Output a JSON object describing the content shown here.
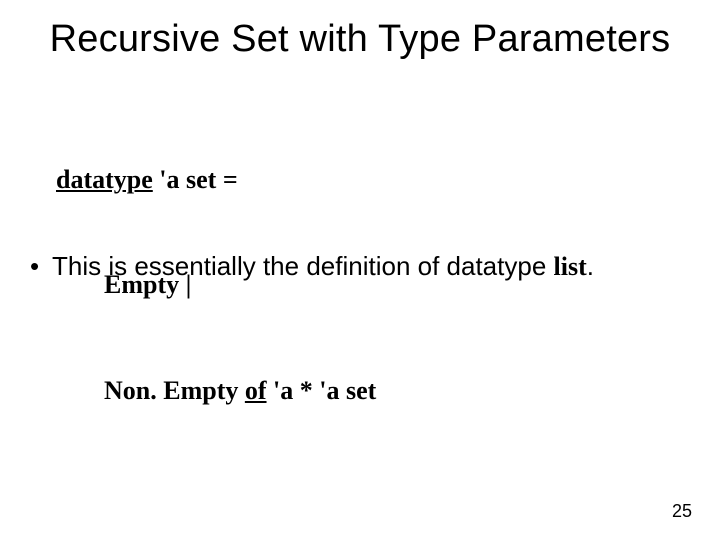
{
  "title": "Recursive Set with Type Parameters",
  "code": {
    "kw_datatype": "datatype",
    "line1_rest": " 'a set =",
    "line2": "Empty |",
    "line3_pre": "Non. Empty ",
    "kw_of": "of",
    "line3_post": " 'a * 'a set"
  },
  "bullet": {
    "marker": "•",
    "text_pre": "This is essentially the definition of datatype ",
    "list_word": "list",
    "text_post": "."
  },
  "page_number": "25"
}
